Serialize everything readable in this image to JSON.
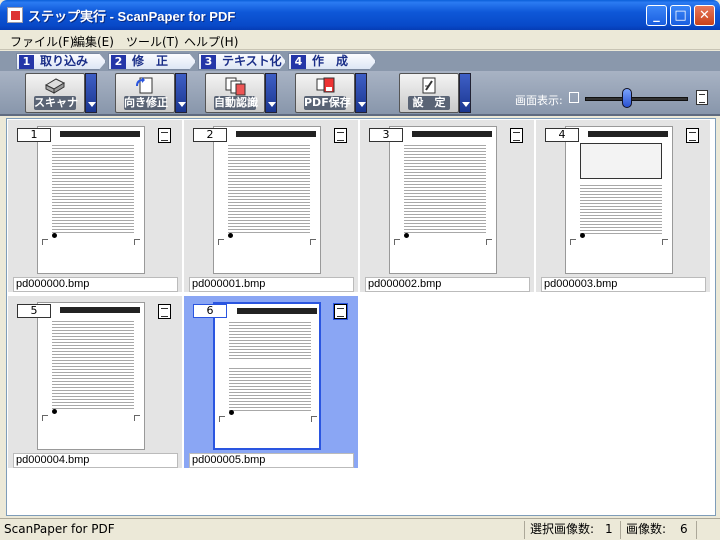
{
  "window": {
    "title": "ステップ実行 - ScanPaper for PDF",
    "min_label": "_",
    "max_label": "□",
    "close_label": "✕"
  },
  "menu": [
    "ファイル(F)",
    "編集(E)",
    "ツール(T)",
    "ヘルプ(H)"
  ],
  "steps": [
    {
      "num": "1",
      "label": "取り込み"
    },
    {
      "num": "2",
      "label": "修　正"
    },
    {
      "num": "3",
      "label": "テキスト化"
    },
    {
      "num": "4",
      "label": "作　成"
    }
  ],
  "toolbar": {
    "scanner": "スキャナ",
    "orientation": "向き修正",
    "auto_recognition": "自動認識",
    "pdf_save": "PDF保存",
    "settings": "設　定"
  },
  "zoom": {
    "label": "画面表示:",
    "value_fraction": 0.4
  },
  "pages": [
    {
      "num": "1",
      "file": "pd000000.bmp",
      "selected": false
    },
    {
      "num": "2",
      "file": "pd000001.bmp",
      "selected": false
    },
    {
      "num": "3",
      "file": "pd000002.bmp",
      "selected": false
    },
    {
      "num": "4",
      "file": "pd000003.bmp",
      "selected": false
    },
    {
      "num": "5",
      "file": "pd000004.bmp",
      "selected": false
    },
    {
      "num": "6",
      "file": "pd000005.bmp",
      "selected": true
    }
  ],
  "status": {
    "app": "ScanPaper for PDF",
    "selected_label": "選択画像数:",
    "selected_count": "1",
    "total_label": "画像数:",
    "total_count": "6"
  },
  "colors": {
    "title_blue": "#0849c8",
    "selection": "#8aa6f4",
    "step_text": "#1a2e88"
  }
}
